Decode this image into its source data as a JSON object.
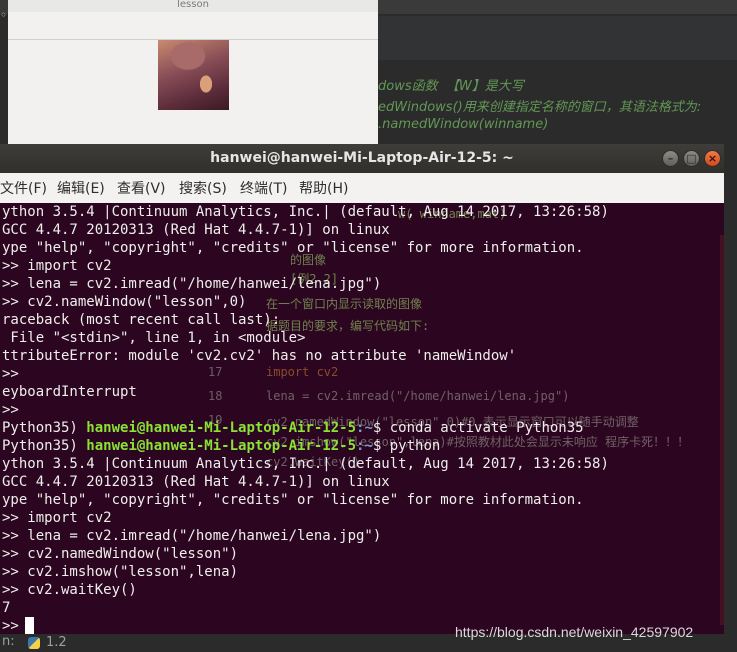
{
  "image_window": {
    "title": "lesson"
  },
  "ide": {
    "comment_lines": [
      "dows函数  【W】是大写",
      "edWindows()用来创建指定名称的窗口，其语法格式为:",
      ".namedWindow(winname)"
    ],
    "status_python_version": "1.2"
  },
  "terminal": {
    "title": "hanwei@hanwei-Mi-Laptop-Air-12-5: ~",
    "menu": [
      "文件(F)",
      "编辑(E)",
      "查看(V)",
      "搜索(S)",
      "终端(T)",
      "帮助(H)"
    ],
    "lines": [
      "ython 3.5.4 |Continuum Analytics, Inc.| (default, Aug 14 2017, 13:26:58)",
      "GCC 4.4.7 20120313 (Red Hat 4.4.7-1)] on linux",
      "ype \"help\", \"copyright\", \"credits\" or \"license\" for more information.",
      ">> import cv2",
      ">> lena = cv2.imread(\"/home/hanwei/lena.jpg\")",
      ">> cv2.nameWindow(\"lesson\",0)",
      "raceback (most recent call last):",
      " File \"<stdin>\", line 1, in <module>",
      "ttributeError: module 'cv2.cv2' has no attribute 'nameWindow'",
      ">>",
      "eyboardInterrupt",
      ">>"
    ],
    "prompt_lines": [
      {
        "env": "Python35) ",
        "userhost": "hanwei@hanwei-Mi-Laptop-Air-12-5",
        "path": ":~",
        "cmd": "$ conda activate Python35"
      },
      {
        "env": "Python35) ",
        "userhost": "hanwei@hanwei-Mi-Laptop-Air-12-5",
        "path": ":~",
        "cmd": "$ python"
      }
    ],
    "lines2": [
      "ython 3.5.4 |Continuum Analytics, Inc.| (default, Aug 14 2017, 13:26:58)",
      "GCC 4.4.7 20120313 (Red Hat 4.4.7-1)] on linux",
      "ype \"help\", \"copyright\", \"credits\" or \"license\" for more information.",
      ">> import cv2",
      ">> lena = cv2.imread(\"/home/hanwei/lena.jpg\")",
      ">> cv2.namedWindow(\"lesson\")",
      ">> cv2.imshow(\"lesson\",lena)",
      ">> cv2.waitKey()",
      "7"
    ],
    "current_prompt": ">>"
  },
  "ghost": {
    "a": "w( winname,mat)",
    "b": "的图像",
    "c": "[例2.2]",
    "d": "在一个窗口内显示读取的图像",
    "e": "据题目的要求，编写代码如下:",
    "ln17": "17",
    "ln18": "18",
    "ln19": "19",
    "code1": "import cv2",
    "code2": "lena = cv2.imread(\"/home/hanwei/lena.jpg\")",
    "code3": "cv2.namedWindow(\"lesson\",0)#0.表示显示窗口可以随手动调整",
    "code4": "cv2.imshow(\"lesson\",lena)#按照教材此处会显示未响应 程序卡死！！！",
    "code5": "cv2.waitKey()"
  },
  "watermark": "https://blog.csdn.net/weixin_42597902"
}
